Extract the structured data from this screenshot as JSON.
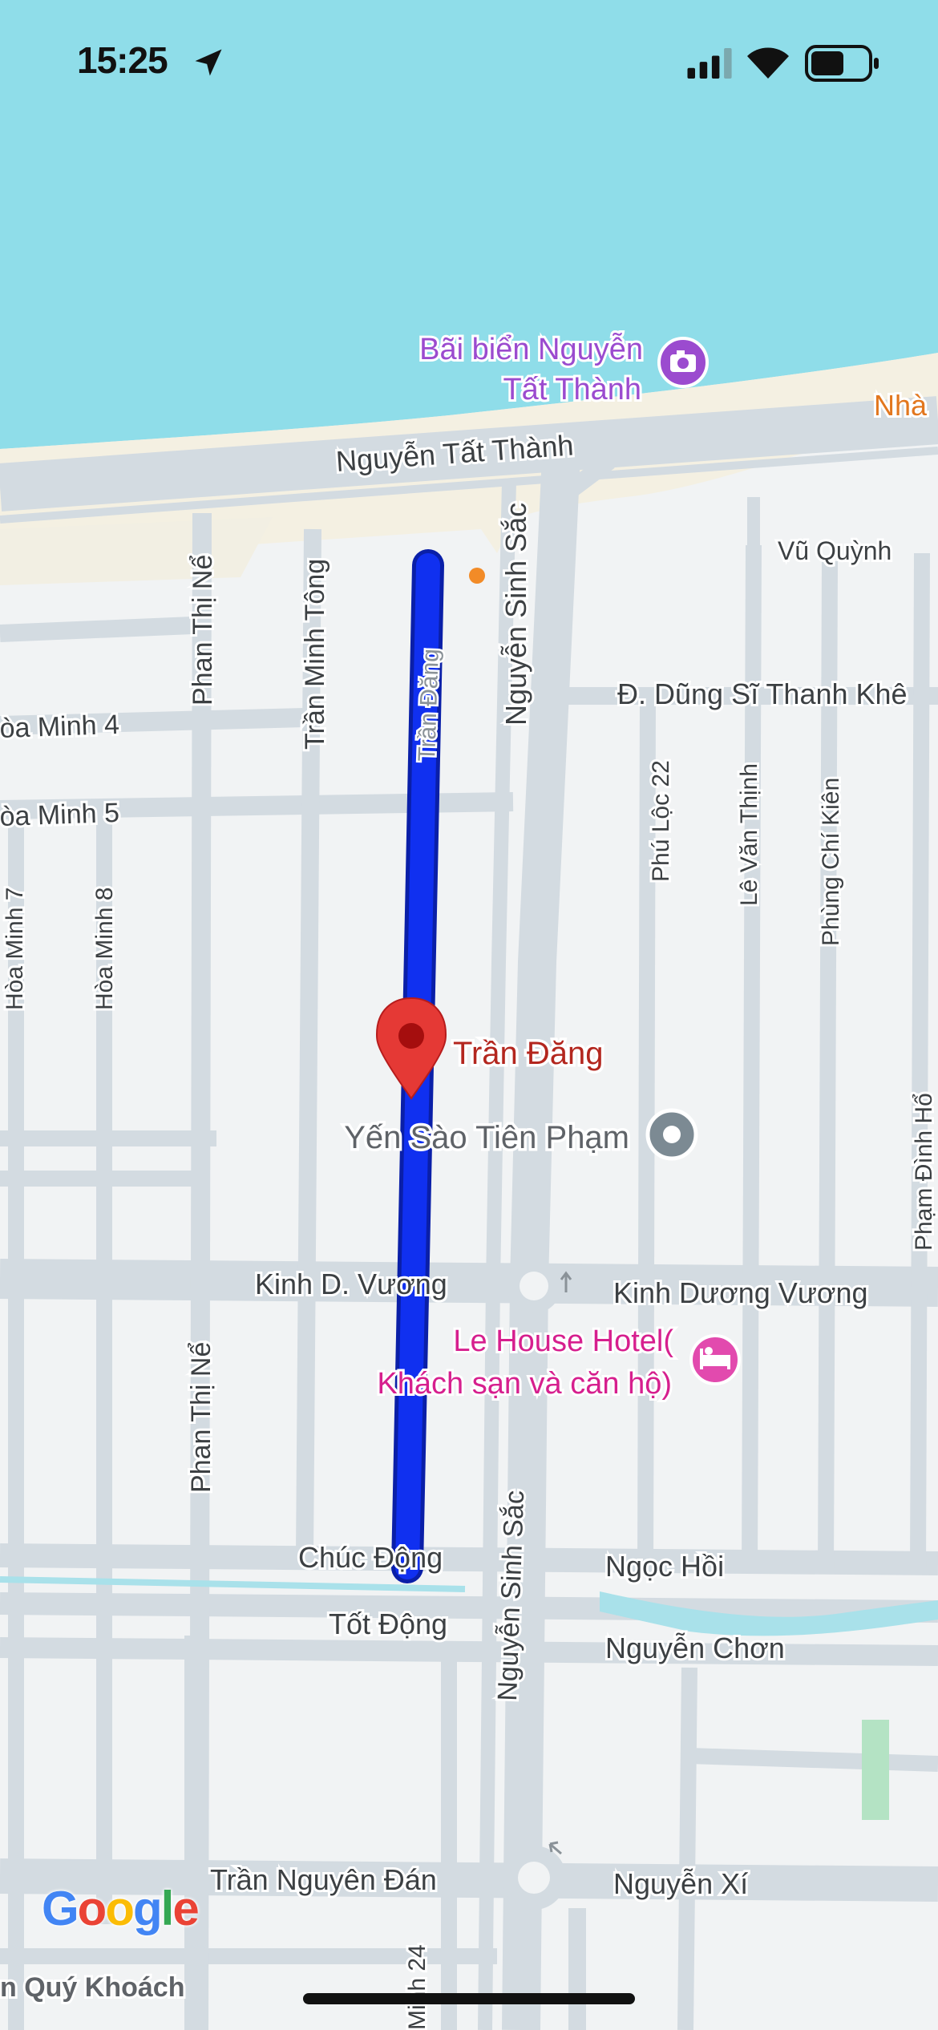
{
  "status_bar": {
    "time": "15:25"
  },
  "map": {
    "pois": {
      "beach": {
        "name_line1": "Bãi biển Nguyễn",
        "name_line2": "Tất Thành",
        "icon": "camera-icon"
      },
      "nha_partial": "Nhà",
      "yen_sao": {
        "name": "Yến Sào Tiên Phạm",
        "icon": "place-icon"
      },
      "hotel": {
        "name_line1": "Le House Hotel(",
        "name_line2": "Khách sạn và căn hộ)",
        "icon": "bed-icon"
      }
    },
    "selected_place": {
      "name": "Trần Đăng",
      "marker": "red-pin-icon"
    },
    "streets": {
      "nguyen_tat_thanh": "Nguyễn Tất Thành",
      "vu_quynh": "Vũ Quỳnh",
      "dung_si_thanh_khe": "Đ. Dũng Sĩ Thanh Khê",
      "hoa_minh_4": "òa Minh 4",
      "hoa_minh_5": "òa Minh 5",
      "hoa_minh_7": "Hòa Minh 7",
      "hoa_minh_8": "Hòa Minh 8",
      "phan_thi_ne_top": "Phan Thị Nể",
      "tran_minh_tong": "Trần Minh Tông",
      "tran_dang_road": "Trần Đăng",
      "nguyen_sinh_sac_top": "Nguyễn Sinh Sắc",
      "phu_loc_22": "Phú Lộc 22",
      "le_van_thinh": "Lê Văn Thịnh",
      "phung_chi_kien": "Phùng Chí Kiên",
      "pham_dinh_ho": "Phạm Đình Hổ",
      "kinh_d_vuong": "Kinh D. Vương",
      "kinh_duong_vuong": "Kinh Dương Vương",
      "phan_thi_ne_bottom": "Phan Thị Nể",
      "nguyen_sinh_sac_bottom": "Nguyễn Sinh Sắc",
      "chuc_dong": "Chúc Động",
      "tot_dong": "Tốt Động",
      "ngoc_hoi": "Ngọc Hồi",
      "nguyen_chon": "Nguyễn Chơn",
      "tran_nguyen_dan": "Trần Nguyên Đán",
      "nguyen_xi": "Nguyễn Xí",
      "minh_24": "Minh 24",
      "quy_khoach": "n Quý Khoách"
    },
    "logo": "Google",
    "colors": {
      "water": "#8FDDE9",
      "sand": "#F4F0E2",
      "land": "#F1F3F4",
      "road": "#D3DBE1",
      "route": "#1030F0",
      "poi_purple": "#9B4BCF",
      "poi_pink": "#D61F8E",
      "pin_red": "#E53935",
      "label_red": "#B3261E",
      "park": "#B4E3C4"
    }
  }
}
